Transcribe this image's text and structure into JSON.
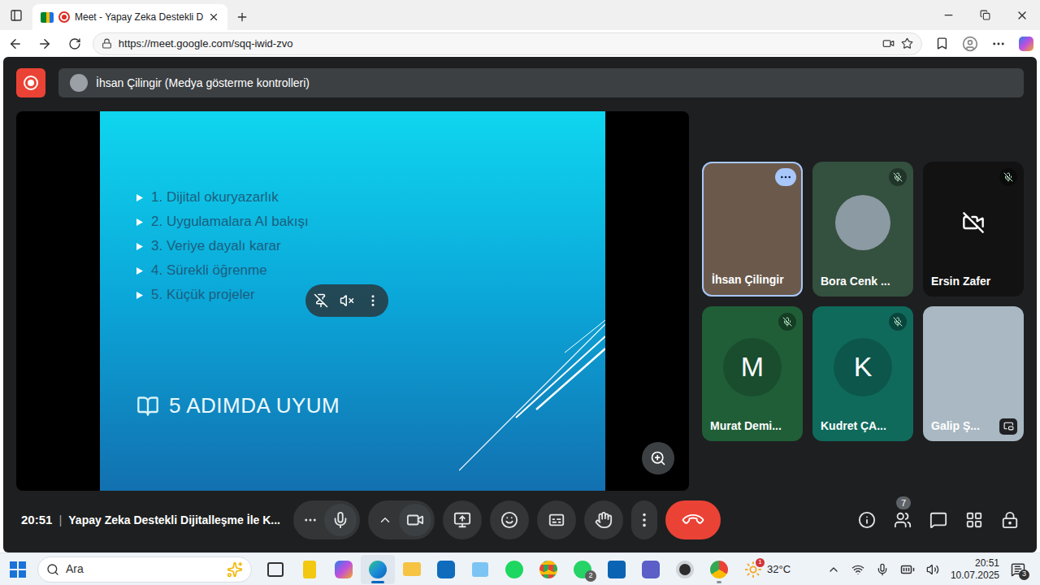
{
  "browser": {
    "tab_title": "Meet - Yapay Zeka Destekli D",
    "recording": true,
    "url": "https://meet.google.com/sqq-iwid-zvo"
  },
  "meeting": {
    "recording": true,
    "banner": "İhsan Çilingir (Medya gösterme kontrolleri)",
    "slide": {
      "items": [
        "1. Dijital okuryazarlık",
        "2. Uygulamalara AI bakışı",
        "3. Veriye dayalı karar",
        "4. Sürekli öğrenme",
        "5. Küçük projeler"
      ],
      "title": "5 ADIMDA UYUM"
    },
    "participants": [
      {
        "name": "İhsan Çilingir",
        "kind": "video",
        "muted": false,
        "speaking": true,
        "pip": false,
        "avatar": "",
        "color": "#6b5a4c"
      },
      {
        "name": "Bora Cenk ...",
        "kind": "photo",
        "muted": true,
        "speaking": false,
        "pip": false,
        "avatar": "",
        "color": "#34503f"
      },
      {
        "name": "Ersin Zafer",
        "kind": "camera-off",
        "muted": true,
        "speaking": false,
        "pip": false,
        "avatar": "",
        "color": "#121212"
      },
      {
        "name": "Murat Demi...",
        "kind": "letter",
        "muted": true,
        "speaking": false,
        "pip": false,
        "avatar": "M",
        "color": "#1f5e37"
      },
      {
        "name": "Kudret ÇA...",
        "kind": "letter",
        "muted": true,
        "speaking": false,
        "pip": false,
        "avatar": "K",
        "color": "#0f6a5c"
      },
      {
        "name": "Galip Ş...",
        "kind": "video",
        "muted": false,
        "speaking": false,
        "pip": true,
        "avatar": "",
        "color": "#a9b8c2"
      }
    ],
    "time": "20:51",
    "separator": "|",
    "title": "Yapay Zeka Destekli Dijitalleşme İle K...",
    "controls": {
      "mic_on": true,
      "camera_on": true
    },
    "participant_count": "7"
  },
  "taskbar": {
    "search_placeholder": "Ara",
    "apps": [
      {
        "open": false,
        "selected": false,
        "badge": ""
      },
      {
        "open": false,
        "selected": false,
        "badge": ""
      },
      {
        "open": false,
        "selected": false,
        "badge": ""
      },
      {
        "open": true,
        "selected": true,
        "badge": ""
      },
      {
        "open": false,
        "selected": false,
        "badge": ""
      },
      {
        "open": false,
        "selected": false,
        "badge": ""
      },
      {
        "open": false,
        "selected": false,
        "badge": ""
      },
      {
        "open": false,
        "selected": false,
        "badge": ""
      },
      {
        "open": false,
        "selected": false,
        "badge": ""
      },
      {
        "open": false,
        "selected": false,
        "badge": "2"
      },
      {
        "open": false,
        "selected": false,
        "badge": ""
      },
      {
        "open": false,
        "selected": false,
        "badge": ""
      },
      {
        "open": false,
        "selected": false,
        "badge": ""
      },
      {
        "open": true,
        "selected": false,
        "badge": ""
      }
    ],
    "weather_badge": "1",
    "temperature": "32°C",
    "time": "20:51",
    "date": "10.07.2025",
    "notification_count": "3"
  }
}
